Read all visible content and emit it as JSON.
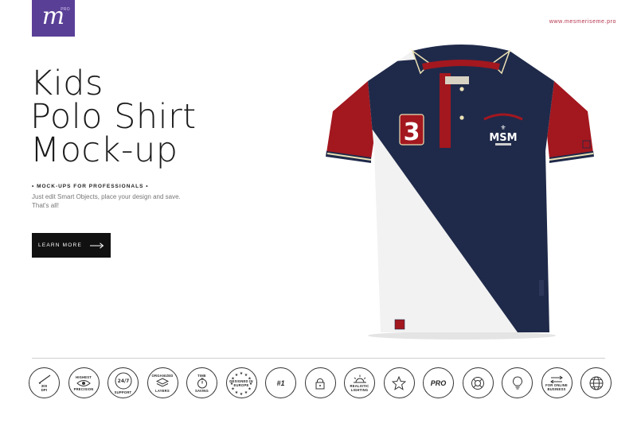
{
  "brand": {
    "logo_letter": "m",
    "logo_sup": "PRO",
    "url": "www.mesmeriseme.pro"
  },
  "hero": {
    "title_lines": [
      "Kids",
      "Polo Shirt",
      "Mock-up"
    ],
    "tagline": "• MOCK-UPS FOR PROFESSIONALS •",
    "description_1": "Just edit Smart Objects, place your design and save.",
    "description_2": "That's all!",
    "cta_label": "LEARN MORE"
  },
  "shirt": {
    "number": "3",
    "monogram": "MSM",
    "colors": {
      "navy": "#1f2a4a",
      "red": "#a3171f",
      "white": "#f2f2f2",
      "cream": "#ece1b5"
    }
  },
  "features": [
    {
      "icon": "300-dpi-icon",
      "line1": "300",
      "line2": "DPI"
    },
    {
      "icon": "eye-icon",
      "line1": "HIGHEST",
      "line2": "PRECISION"
    },
    {
      "icon": "support-icon",
      "line1": "24/7",
      "line2": "SUPPORT"
    },
    {
      "icon": "layers-icon",
      "line1": "ORGANIZED",
      "line2": "LAYERS"
    },
    {
      "icon": "timer-icon",
      "line1": "TIME",
      "line2": "SAVING"
    },
    {
      "icon": "europe-stars-icon",
      "line1": "DESIGNED IN",
      "line2": "EUROPE"
    },
    {
      "icon": "number-one-icon",
      "line1": "#1",
      "line2": ""
    },
    {
      "icon": "lock-icon",
      "line1": "",
      "line2": ""
    },
    {
      "icon": "sun-icon",
      "line1": "REALISTIC",
      "line2": "LIGHTING"
    },
    {
      "icon": "star-icon",
      "line1": "",
      "line2": ""
    },
    {
      "icon": "pro-icon",
      "line1": "PRO",
      "line2": ""
    },
    {
      "icon": "lifebuoy-icon",
      "line1": "",
      "line2": ""
    },
    {
      "icon": "lightbulb-icon",
      "line1": "",
      "line2": ""
    },
    {
      "icon": "exchange-icon",
      "line1": "FOR ONLINE",
      "line2": "BUSINESS"
    },
    {
      "icon": "globe-icon",
      "line1": "",
      "line2": ""
    }
  ]
}
